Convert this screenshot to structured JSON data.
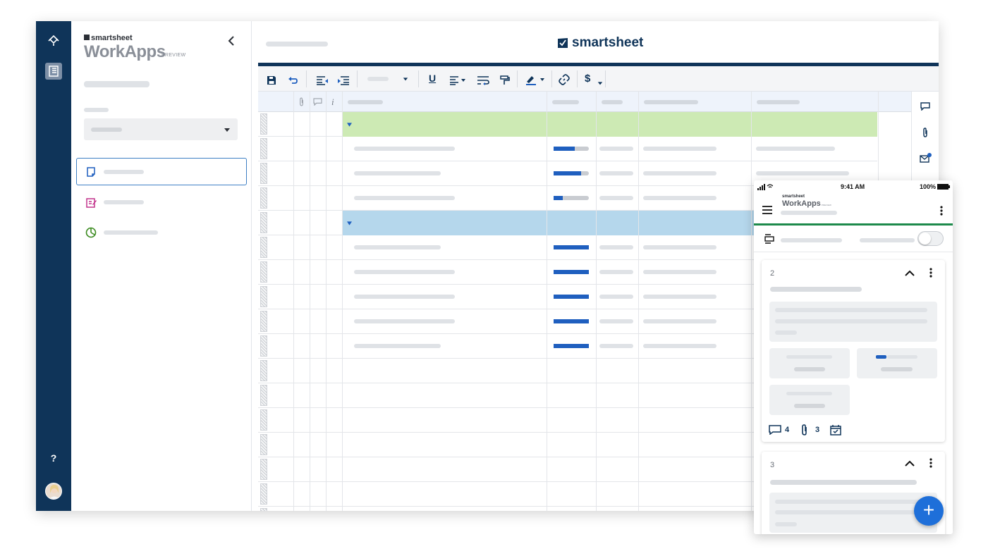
{
  "rail": {
    "help_label": "?"
  },
  "sidebar": {
    "brand_small": "smartsheet",
    "brand_big": "WorkApps",
    "brand_tag": "PREVIEW"
  },
  "sheet": {
    "brand": "smartsheet",
    "toolbar": {
      "underline": "U",
      "currency": "$"
    }
  },
  "phone": {
    "status_time": "9:41 AM",
    "status_battery": "100%",
    "brand_small": "smartsheet",
    "brand_big": "WorkApps",
    "brand_tag": "PREVIEW",
    "cards": [
      {
        "number": "2",
        "comments": "4",
        "attachments": "3"
      },
      {
        "number": "3"
      }
    ],
    "fab_label": "+"
  },
  "colors": {
    "navy": "#0f3459",
    "group_green": "#cdeab4",
    "group_blue": "#b5d7ec",
    "progress_blue": "#1f5fbf",
    "phone_accent": "#1d8a4b",
    "fab": "#1e6fd9"
  }
}
